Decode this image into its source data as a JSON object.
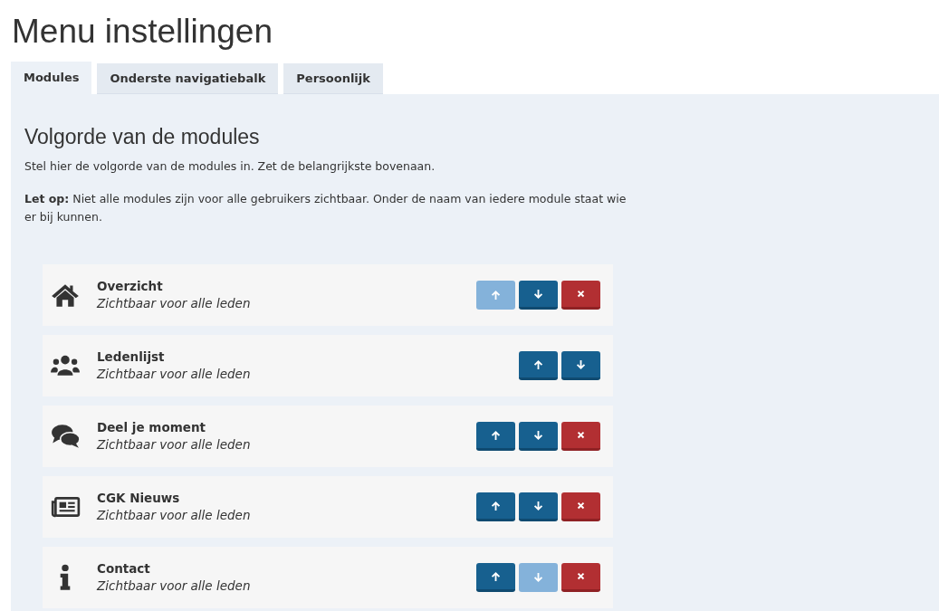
{
  "page_title": "Menu instellingen",
  "tabs": [
    {
      "label": "Modules",
      "selected": true
    },
    {
      "label": "Onderste navigatiebalk",
      "selected": false
    },
    {
      "label": "Persoonlijk",
      "selected": false
    }
  ],
  "section": {
    "heading": "Volgorde van de modules",
    "intro": "Stel hier de volgorde van de modules in. Zet de belangrijkste bovenaan.",
    "note": "**Let op:** Niet alle modules zijn voor alle gebruikers zichtbaar. Onder de naam van iedere module staat wie er bij kunnen."
  },
  "modules": [
    {
      "kind": "home",
      "name": "Overzicht",
      "visibility": "Zichtbaar voor alle leden",
      "up_disabled": true,
      "down_disabled": false,
      "removable": true
    },
    {
      "kind": "users",
      "name": "Ledenlijst",
      "visibility": "Zichtbaar voor alle leden",
      "up_disabled": false,
      "down_disabled": false,
      "removable": false
    },
    {
      "kind": "comments",
      "name": "Deel je moment",
      "visibility": "Zichtbaar voor alle leden",
      "up_disabled": false,
      "down_disabled": false,
      "removable": true
    },
    {
      "kind": "newspaper",
      "name": "CGK Nieuws",
      "visibility": "Zichtbaar voor alle leden",
      "up_disabled": false,
      "down_disabled": false,
      "removable": true
    },
    {
      "kind": "info",
      "name": "Contact",
      "visibility": "Zichtbaar voor alle leden",
      "up_disabled": false,
      "down_disabled": true,
      "removable": true
    }
  ]
}
